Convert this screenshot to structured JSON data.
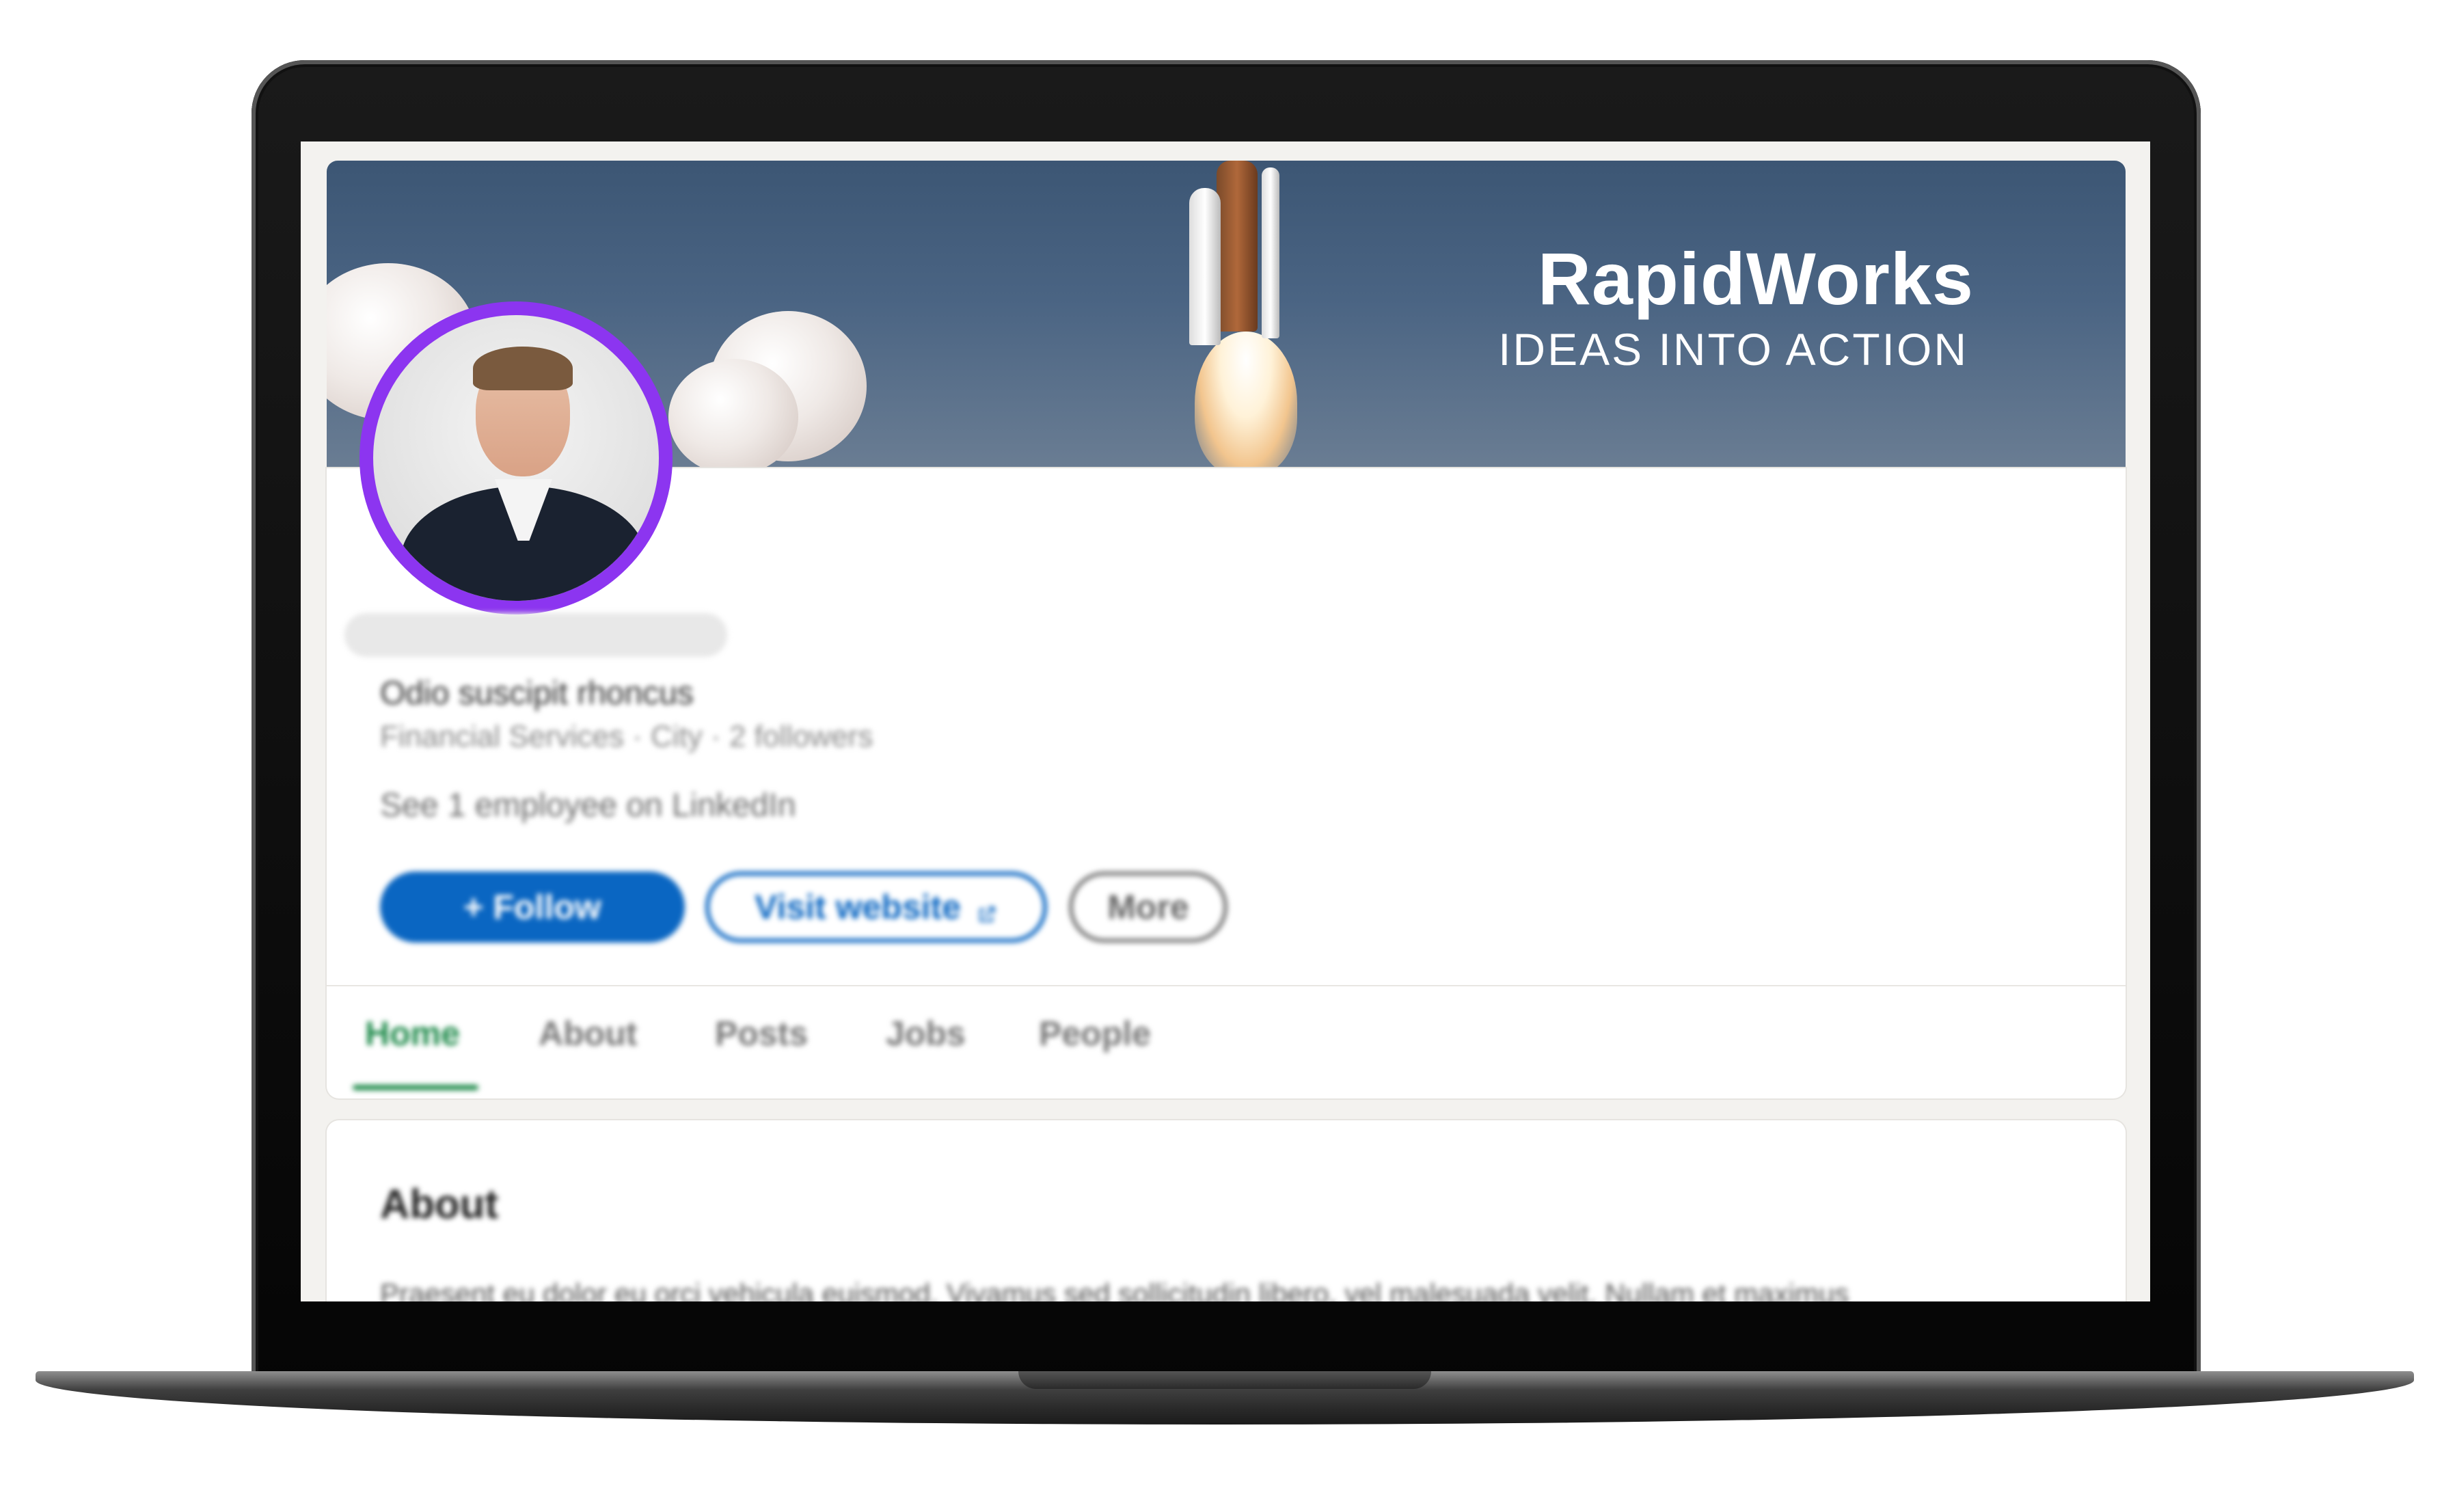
{
  "cover": {
    "brand": "RapidWorks",
    "tagline": "IDEAS INTO ACTION"
  },
  "company": {
    "name": "Odio suscipit rhoncus",
    "meta": "Financial Services · City · 2 followers",
    "employees": "See 1 employee on LinkedIn"
  },
  "actions": {
    "follow": "+ Follow",
    "visit": "Visit website",
    "visit_icon": "external-link-icon",
    "more": "More"
  },
  "tabs": [
    {
      "label": "Home",
      "active": true
    },
    {
      "label": "About"
    },
    {
      "label": "Posts"
    },
    {
      "label": "Jobs"
    },
    {
      "label": "People"
    }
  ],
  "about": {
    "heading": "About",
    "text": "Praesent eu dolor eu orci vehicula euismod. Vivamus sed sollicitudin libero, vel malesuada velit. Nullam et maximus"
  },
  "colors": {
    "accent": "#0a66c2",
    "avatar_ring": "#8c35f0",
    "active_tab": "#1e8a4a"
  }
}
